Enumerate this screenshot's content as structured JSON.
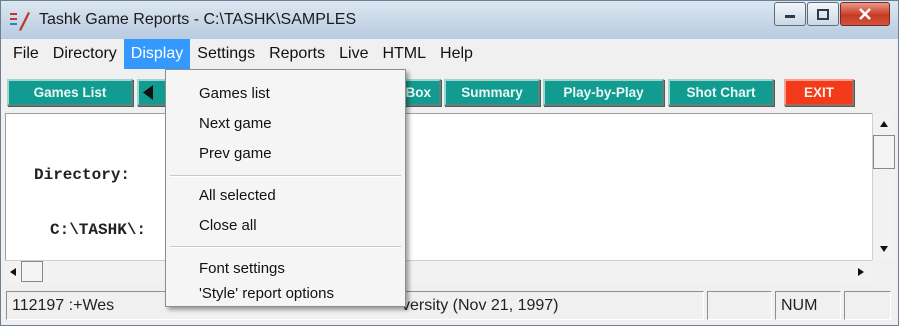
{
  "window": {
    "title": "Tashk Game Reports - C:\\TASHK\\SAMPLES"
  },
  "menu": {
    "items": [
      "File",
      "Directory",
      "Display",
      "Settings",
      "Reports",
      "Live",
      "HTML",
      "Help"
    ],
    "active": "Display"
  },
  "toolbar": {
    "games_list": "Games List",
    "box": "Box",
    "summary": "Summary",
    "play_by_play": "Play-by-Play",
    "shot_chart": "Shot Chart",
    "exit": "EXIT"
  },
  "content": {
    "directory_label": "Directory:",
    "directory_path": "C:\\TASHK\\:"
  },
  "display_menu": {
    "group1": [
      "Games list",
      "Next game",
      "Prev game"
    ],
    "group2": [
      "All selected",
      "Close all"
    ],
    "group3": [
      "Font settings",
      "'Style' report options"
    ]
  },
  "status": {
    "game_left": "112197  :+Wes",
    "game_right": "versity (Nov 21, 1997)",
    "num": "NUM"
  },
  "colors": {
    "toolbar_button": "#129c91",
    "exit_button": "#f33a1a",
    "menu_highlight": "#3399ff"
  }
}
